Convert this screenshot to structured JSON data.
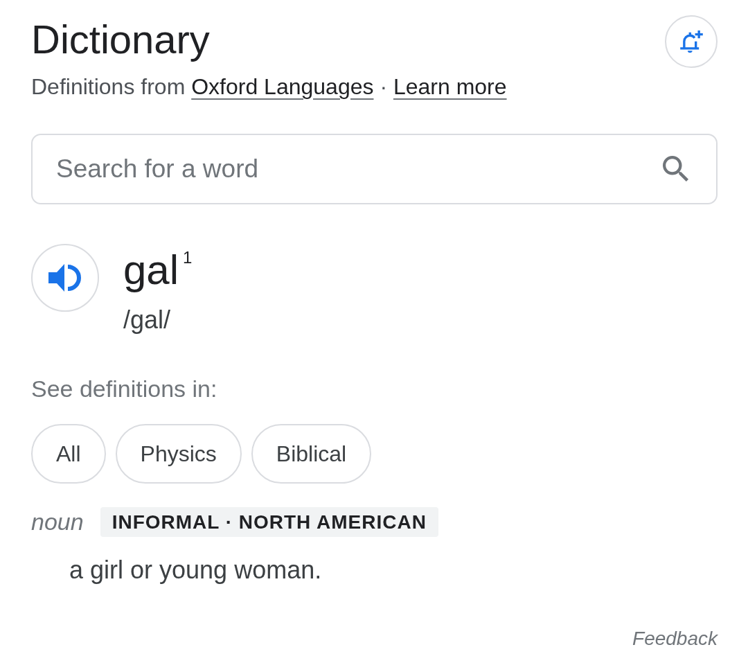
{
  "header": {
    "title": "Dictionary",
    "attribution": "Definitions from",
    "source_link": "Oxford Languages",
    "separator": "·",
    "learn_more_link": "Learn more"
  },
  "search": {
    "placeholder": "Search for a word"
  },
  "entry": {
    "headword": "gal$^{1}$",
    "phonetic": "/gal/"
  },
  "filters": {
    "label": "See definitions in:",
    "chips": [
      {
        "label": "All",
        "selected": false
      },
      {
        "label": "Physics",
        "selected": false
      },
      {
        "label": "Biblical",
        "selected": false
      }
    ]
  },
  "sense": {
    "part_of_speech": "noun",
    "register": "INFORMAL · NORTH AMERICAN",
    "definitions": [
      "a girl or young woman."
    ]
  },
  "feedback": "Feedback"
}
